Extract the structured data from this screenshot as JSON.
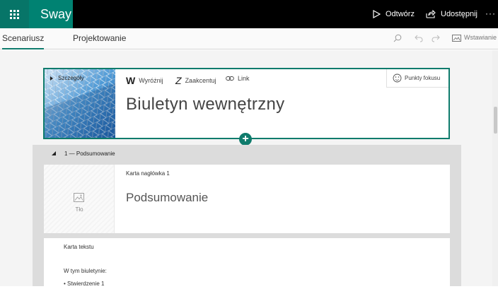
{
  "app": {
    "name": "Sway",
    "play_label": "Odtwórz",
    "share_label": "Udostępnij",
    "more_label": "···"
  },
  "tabs": {
    "storyline": "Scenariusz",
    "design": "Projektowanie",
    "insert_label": "Wstawianie"
  },
  "title_card": {
    "details_label": "Szczegóły",
    "emphasize_label": "Wyróżnij",
    "emphasize_glyph": "W",
    "accent_label": "Zaakcentuj",
    "accent_glyph": "Z",
    "link_label": "Link",
    "focus_points_label": "Punkty fokusu",
    "title": "Biuletyn wewnętrzny",
    "add_glyph": "+"
  },
  "section": {
    "header": "1 — Podsumowanie",
    "heading_card": {
      "label": "Karta nagłówka 1",
      "background_label": "Tło",
      "title": "Podsumowanie"
    },
    "text_card": {
      "label": "Karta tekstu",
      "intro": "W tym biuletynie:",
      "bullet_1": "• Stwierdzenie 1"
    }
  },
  "colors": {
    "accent": "#0f7b6c",
    "brand": "#008272",
    "topbar": "#000000"
  }
}
